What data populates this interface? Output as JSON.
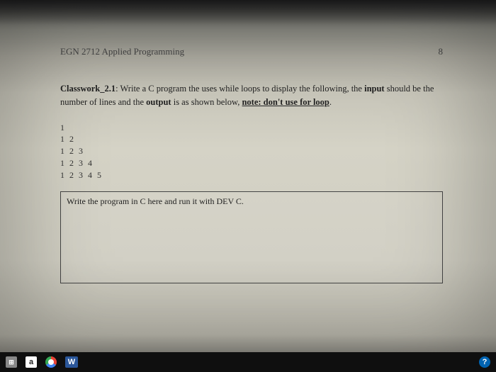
{
  "header": {
    "course": "EGN 2712 Applied Programming",
    "page_number": "8"
  },
  "assignment": {
    "title": "Classwork_2.1",
    "prompt_1": ": Write a C program the uses while loops to display the following, the ",
    "input_word": "input",
    "prompt_2": " should be the number of lines and the ",
    "output_word": "output",
    "prompt_3": " is as shown below, ",
    "note_label": "note: don't use for loop",
    "period": "."
  },
  "pattern": {
    "lines": [
      "1",
      "1 2",
      "1 2 3",
      "1 2 3 4",
      "1 2 3 4 5"
    ]
  },
  "code_box": {
    "instruction": "Write the program in C here and run it with DEV C."
  },
  "taskbar": {
    "amazon": "a",
    "word": "W",
    "store": "⊞"
  }
}
